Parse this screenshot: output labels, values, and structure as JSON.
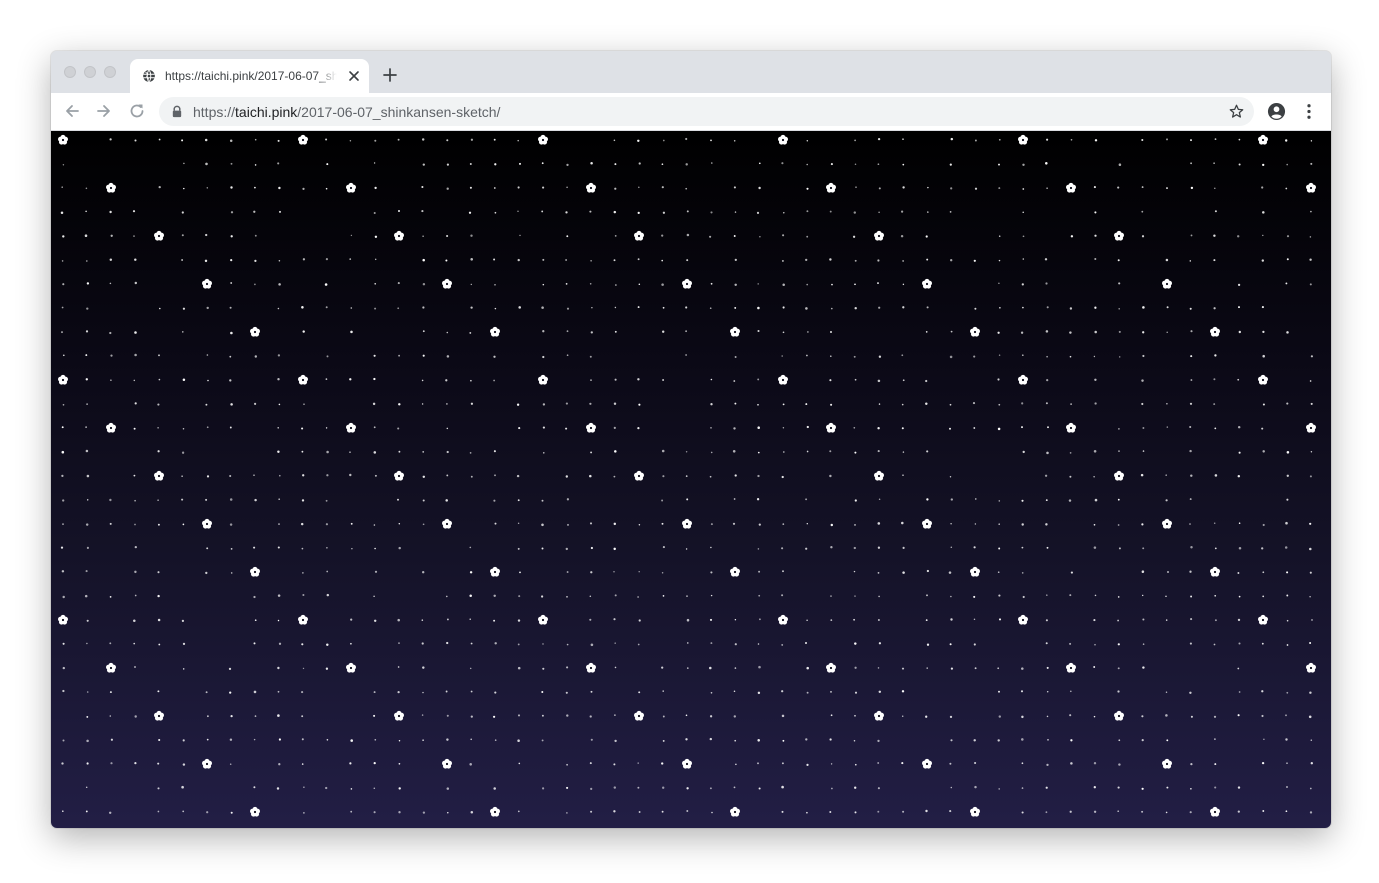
{
  "browser": {
    "tab": {
      "title": "https://taichi.pink/2017-06-07_shinkansen-sketch/",
      "favicon": "globe-icon"
    },
    "address_bar": {
      "url_scheme": "https://",
      "url_host": "taichi.pink",
      "url_path": "/2017-06-07_shinkansen-sketch/"
    },
    "icons": {
      "back": "arrow-left-icon",
      "forward": "arrow-right-icon",
      "reload": "reload-icon",
      "secure": "lock-icon",
      "bookmark": "star-icon",
      "profile": "account-circle-icon",
      "menu": "more-vert-icon",
      "new_tab": "plus-icon",
      "close_tab": "close-icon"
    }
  },
  "page": {
    "background_top": "#000000",
    "background_bottom": "#221e45",
    "pattern": {
      "flower_color": "#ffffff",
      "dot_color": "#ffffff",
      "flower_glyph": "✿"
    }
  }
}
